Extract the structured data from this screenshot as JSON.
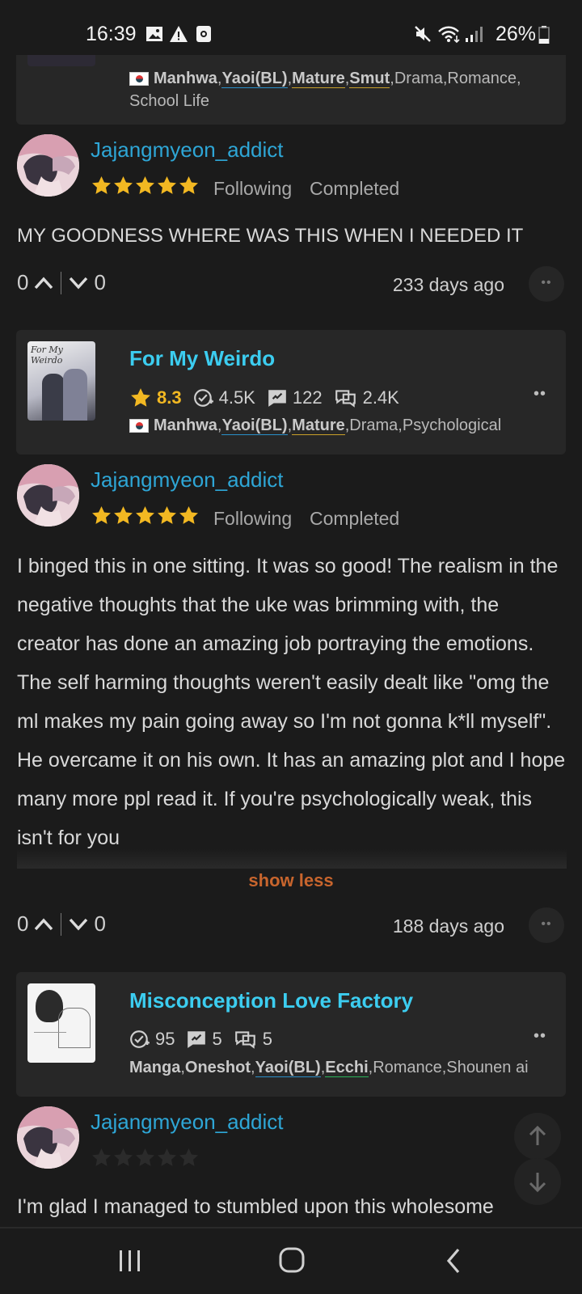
{
  "status_bar": {
    "time": "16:39",
    "battery": "26%"
  },
  "feed": [
    {
      "manga": {
        "genres_bold": [
          "Manhwa",
          "Yaoi(BL)",
          "Mature",
          "Smut"
        ],
        "genres_rest": ",Drama,Romance,",
        "genres_line2": "School Life"
      },
      "review": {
        "user": "Jajangmyeon_addict",
        "status1": "Following",
        "status2": "Completed",
        "text": "MY GOODNESS WHERE WAS THIS WHEN I NEEDED IT",
        "up": "0",
        "down": "0",
        "ago": "233 days ago"
      }
    },
    {
      "manga": {
        "title": "For My Weirdo",
        "rating": "8.3",
        "follows": "4.5K",
        "reviews": "122",
        "comments": "2.4K",
        "genres_bold": [
          "Manhwa",
          "Yaoi(BL)",
          "Mature"
        ],
        "genres_rest": ",Drama,Psychological"
      },
      "review": {
        "user": "Jajangmyeon_addict",
        "status1": "Following",
        "status2": "Completed",
        "text": "I binged this in one sitting. It was so good! The realism in the negative thoughts that the uke was brimming with, the creator has done an amazing job portraying the emotions. The self harming thoughts weren't easily dealt like \"omg the ml makes my pain going away so I'm not gonna k*ll myself\". He overcame it on his own. It has an amazing plot and I hope many more ppl read it. If you're psychologically weak, this isn't for you",
        "toggle": "show less",
        "up": "0",
        "down": "0",
        "ago": "188 days ago"
      }
    },
    {
      "manga": {
        "title": "Misconception Love Factory",
        "follows": "95",
        "reviews": "5",
        "comments": "5",
        "genres_bold": [
          "Manga",
          "Oneshot",
          "Yaoi(BL)",
          "Ecchi"
        ],
        "genres_rest": ",Romance,Shounen ai"
      },
      "review": {
        "user": "Jajangmyeon_addict",
        "text": "I'm glad I managed to stumbled upon this wholesome"
      }
    }
  ],
  "colors": {
    "background": "#1b1b1b",
    "card": "#272727",
    "title": "#3ccdf0",
    "username": "#2ea6d6",
    "star": "#f2b822",
    "show_less": "#c8652d"
  },
  "icons": [
    "image-icon",
    "warning-icon",
    "screen-record-icon",
    "mute-icon",
    "wifi-icon",
    "signal-icon",
    "battery-icon",
    "star-icon",
    "follow-check-icon",
    "review-icon",
    "comments-icon",
    "chevron-up-icon",
    "chevron-down-icon",
    "more-icon",
    "scroll-up-icon",
    "scroll-down-icon",
    "nav-recents-icon",
    "nav-home-icon",
    "nav-back-icon"
  ]
}
